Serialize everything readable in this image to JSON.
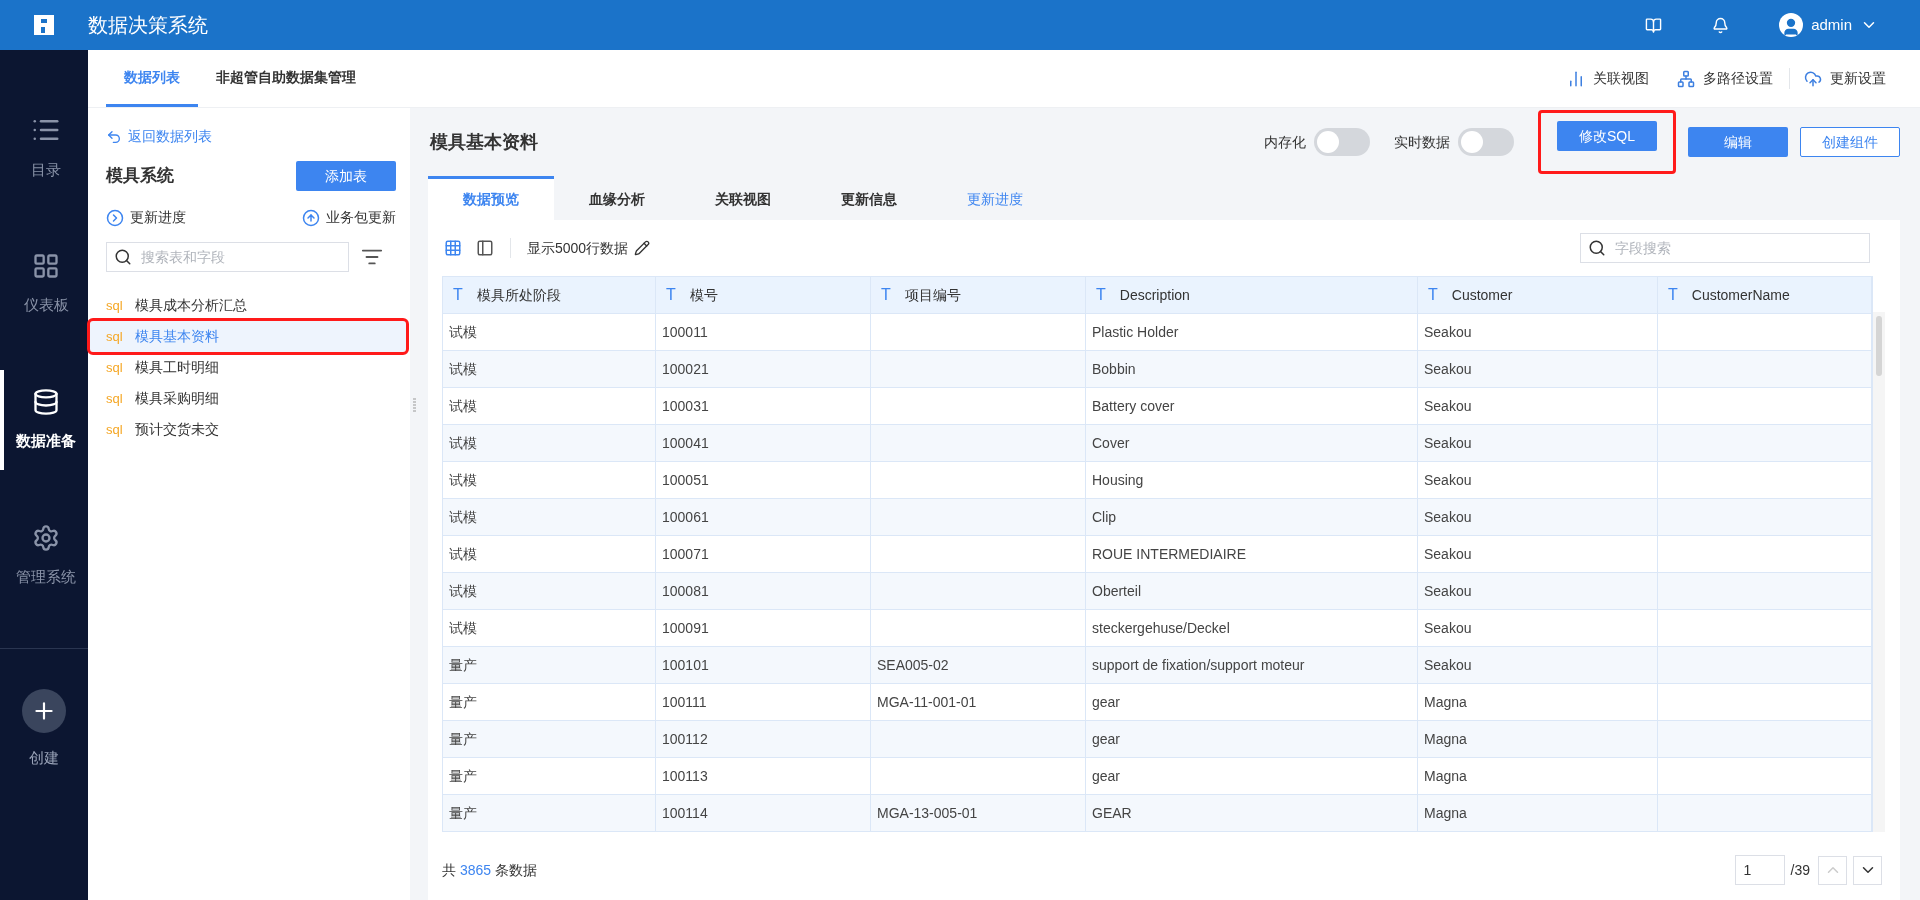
{
  "app": {
    "title": "数据决策系统",
    "user": "admin"
  },
  "nav": [
    {
      "label": "目录",
      "kind": "list",
      "selected": false
    },
    {
      "label": "仪表板",
      "kind": "dashboard",
      "selected": false
    },
    {
      "label": "数据准备",
      "kind": "database",
      "selected": true
    },
    {
      "label": "管理系统",
      "kind": "settings",
      "selected": false
    }
  ],
  "create": {
    "label": "创建"
  },
  "panel_tabs": [
    {
      "label": "数据列表",
      "selected": true
    },
    {
      "label": "非超管自助数据集管理",
      "selected": false
    }
  ],
  "top_actions": [
    {
      "label": "关联视图",
      "kind": "view"
    },
    {
      "label": "多路径设置",
      "kind": "tree"
    },
    {
      "label": "更新设置",
      "kind": "cloud"
    }
  ],
  "sidebar": {
    "back_link": "返回数据列表",
    "group_title": "模具系统",
    "add_button": "添加表",
    "update_progress": "更新进度",
    "package_update": "业务包更新",
    "search_placeholder": "搜索表和字段",
    "tables": [
      {
        "badge": "sql",
        "name": "模具成本分析汇总",
        "selected": false,
        "highlighted": false
      },
      {
        "badge": "sql",
        "name": "模具基本资料",
        "selected": true,
        "highlighted": true
      },
      {
        "badge": "sql",
        "name": "模具工时明细",
        "selected": false,
        "highlighted": false
      },
      {
        "badge": "sql",
        "name": "模具采购明细",
        "selected": false,
        "highlighted": false
      },
      {
        "badge": "sql",
        "name": "预计交货未交",
        "selected": false,
        "highlighted": false
      }
    ]
  },
  "header": {
    "title": "模具基本资料",
    "toggles": [
      {
        "label": "内存化",
        "on": false
      },
      {
        "label": "实时数据",
        "on": false
      }
    ],
    "buttons": [
      {
        "label": "修改SQL",
        "kind": "primary",
        "highlighted": true
      },
      {
        "label": "编辑",
        "kind": "primary",
        "highlighted": false
      },
      {
        "label": "创建组件",
        "kind": "outline",
        "highlighted": false
      }
    ]
  },
  "content_tabs": [
    {
      "label": "数据预览",
      "kind": "tab",
      "selected": true
    },
    {
      "label": "血缘分析",
      "kind": "tab",
      "selected": false
    },
    {
      "label": "关联视图",
      "kind": "tab",
      "selected": false
    },
    {
      "label": "更新信息",
      "kind": "tab",
      "selected": false
    },
    {
      "label": "更新进度",
      "kind": "link",
      "selected": false
    }
  ],
  "toolbar": {
    "rows_label": "显示5000行数据",
    "field_search_placeholder": "字段搜索"
  },
  "table": {
    "columns": [
      {
        "type_icon": "T",
        "label": "模具所处阶段"
      },
      {
        "type_icon": "T",
        "label": "模号"
      },
      {
        "type_icon": "T",
        "label": "项目编号"
      },
      {
        "type_icon": "T",
        "label": "Description"
      },
      {
        "type_icon": "T",
        "label": "Customer"
      },
      {
        "type_icon": "T",
        "label": "CustomerName"
      }
    ],
    "rows": [
      [
        "试模",
        "100011",
        "",
        "Plastic Holder",
        "Seakou",
        ""
      ],
      [
        "试模",
        "100021",
        "",
        "Bobbin",
        "Seakou",
        ""
      ],
      [
        "试模",
        "100031",
        "",
        "Battery cover",
        "Seakou",
        ""
      ],
      [
        "试模",
        "100041",
        "",
        "Cover",
        "Seakou",
        ""
      ],
      [
        "试模",
        "100051",
        "",
        "Housing",
        "Seakou",
        ""
      ],
      [
        "试模",
        "100061",
        "",
        "Clip",
        "Seakou",
        ""
      ],
      [
        "试模",
        "100071",
        "",
        "ROUE INTERMEDIAIRE",
        "Seakou",
        ""
      ],
      [
        "试模",
        "100081",
        "",
        "Oberteil",
        "Seakou",
        ""
      ],
      [
        "试模",
        "100091",
        "",
        "steckergehuse/Deckel",
        "Seakou",
        ""
      ],
      [
        "量产",
        "100101",
        "SEA005-02",
        "support de fixation/support moteur",
        "Seakou",
        ""
      ],
      [
        "量产",
        "100111",
        "MGA-11-001-01",
        "gear",
        "Magna",
        ""
      ],
      [
        "量产",
        "100112",
        "",
        "gear",
        "Magna",
        ""
      ],
      [
        "量产",
        "100113",
        "",
        "gear",
        "Magna",
        ""
      ],
      [
        "量产",
        "100114",
        "MGA-13-005-01",
        "GEAR",
        "Magna",
        ""
      ]
    ]
  },
  "footer": {
    "total_prefix": "共",
    "total_count": "3865",
    "total_suffix": "条数据",
    "page": "1",
    "page_total": "/39"
  }
}
